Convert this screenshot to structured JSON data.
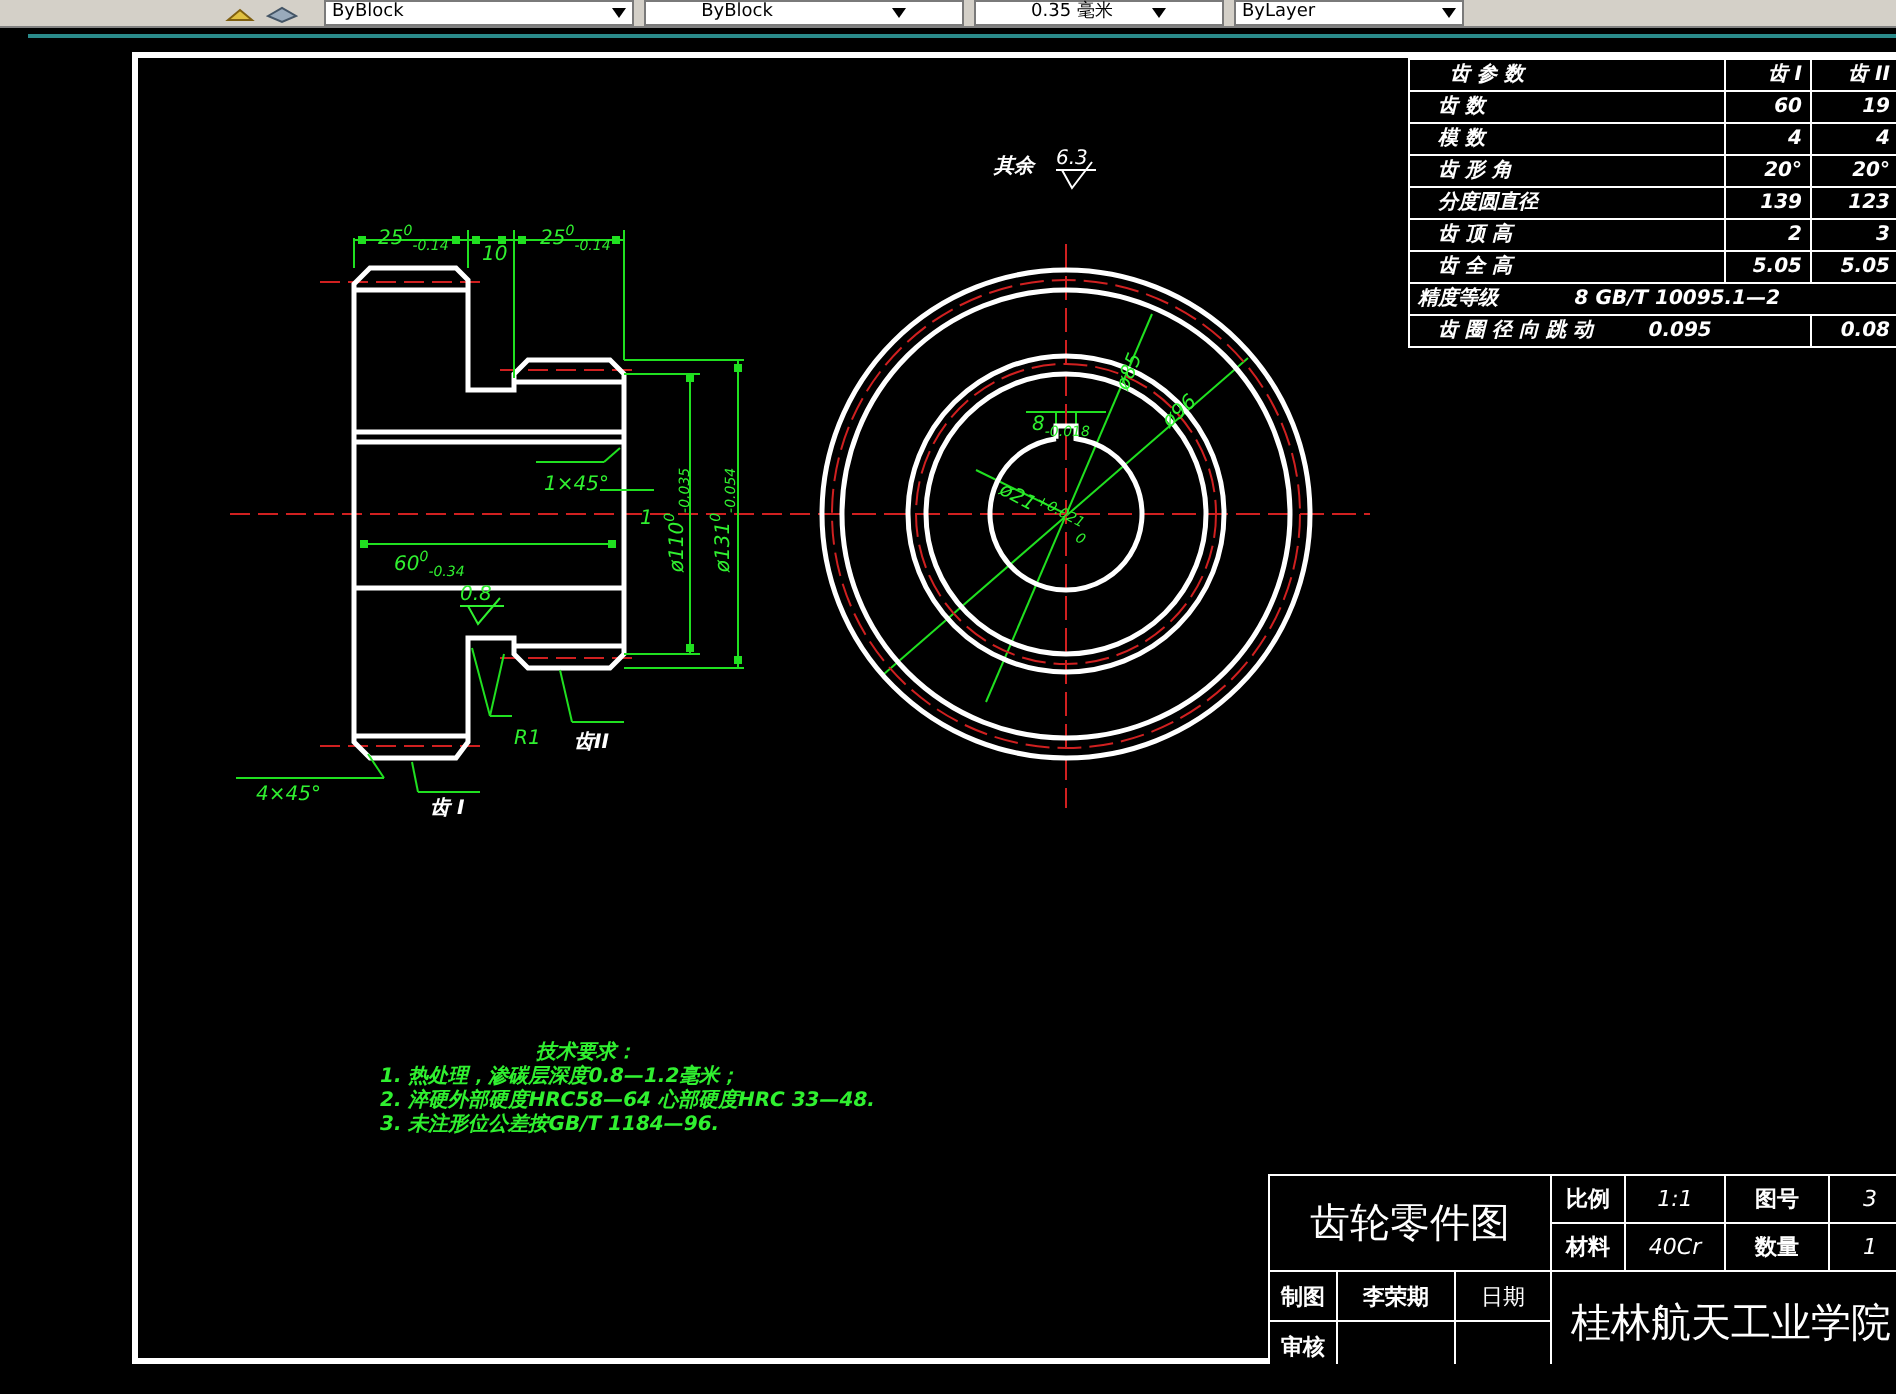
{
  "toolbar": {
    "dropdowns": [
      {
        "value": "ByBlock"
      },
      {
        "value": "ByBlock"
      },
      {
        "value": "0.35 毫米"
      },
      {
        "value": "ByLayer"
      }
    ]
  },
  "front_view": {
    "labels": [
      {
        "kind": "dimension",
        "text": "25$^{0}$$_{-0.14}$"
      },
      {
        "kind": "dimension",
        "text": "10"
      },
      {
        "kind": "dimension",
        "text": "25$^{0}$$_{-0.14}$"
      },
      {
        "kind": "dimension",
        "text": "1×45°"
      },
      {
        "kind": "dimension",
        "text": "1"
      },
      {
        "kind": "dimension",
        "text": "ø110$^{0}$$_{-0.035}$"
      },
      {
        "kind": "dimension",
        "text": "ø131$^{0}$$_{-0.054}$"
      },
      {
        "kind": "dimension",
        "text": "60$^{0}$$_{-0.34}$"
      },
      {
        "kind": "roughness",
        "text": "0.8"
      },
      {
        "kind": "dimension",
        "text": "R1"
      },
      {
        "kind": "note",
        "text": "齿II"
      },
      {
        "kind": "dimension",
        "text": "4×45°"
      },
      {
        "kind": "note",
        "text": "齿 I"
      }
    ]
  },
  "side_view": {
    "labels": [
      {
        "kind": "dimension",
        "text": "8$_{-0.018}$"
      },
      {
        "kind": "dimension",
        "text": "ø85"
      },
      {
        "kind": "dimension",
        "text": "ø96"
      },
      {
        "kind": "dimension",
        "text": "ø21$^{+0.021}$$_{0}$"
      }
    ]
  },
  "roughness_note": {
    "text": "其余",
    "value": "6.3"
  },
  "parameter_table": {
    "rows": [
      {
        "kind": "header",
        "cells": [
          "齿 参 数",
          "齿 I",
          "齿 II"
        ]
      },
      {
        "kind": "param",
        "cells": [
          "齿 数",
          "60",
          "19"
        ]
      },
      {
        "kind": "param",
        "cells": [
          "模 数",
          "4",
          "4"
        ]
      },
      {
        "kind": "param",
        "cells": [
          "齿 形 角",
          "20°",
          "20°"
        ]
      },
      {
        "kind": "param",
        "cells": [
          "分度圆直径",
          "139",
          "123"
        ]
      },
      {
        "kind": "param",
        "cells": [
          "齿 顶 高",
          "2",
          "3"
        ]
      },
      {
        "kind": "param",
        "cells": [
          "齿 全 高",
          "5.05",
          "5.05"
        ]
      },
      {
        "kind": "accuracy",
        "cells": [
          "精度等级",
          "8 GB/T 10095.1—2"
        ]
      },
      {
        "kind": "runout",
        "cells": [
          "齿 圈 径 向 跳 动",
          "0.095",
          "0.08"
        ]
      }
    ]
  },
  "technical_requirements": {
    "title": "技术要求：",
    "items": [
      "1. 热处理，渗碳层深度0.8—1.2毫米；",
      "2. 淬硬外部硬度HRC58—64  心部硬度HRC 33—48.",
      "3. 未注形位公差按GB/T 1184—96."
    ]
  },
  "title_block": {
    "title": "齿轮零件图",
    "scale_label": "比例",
    "scale": "1:1",
    "drawing_no_label": "图号",
    "drawing_no": "3",
    "material_label": "材料",
    "material": "40Cr",
    "quantity_label": "数量",
    "quantity": "1",
    "drawn_by_label": "制图",
    "drawn_by": "李荣期",
    "date_label": "日期",
    "checked_by_label": "审核",
    "school": "桂林航天工业学院"
  }
}
